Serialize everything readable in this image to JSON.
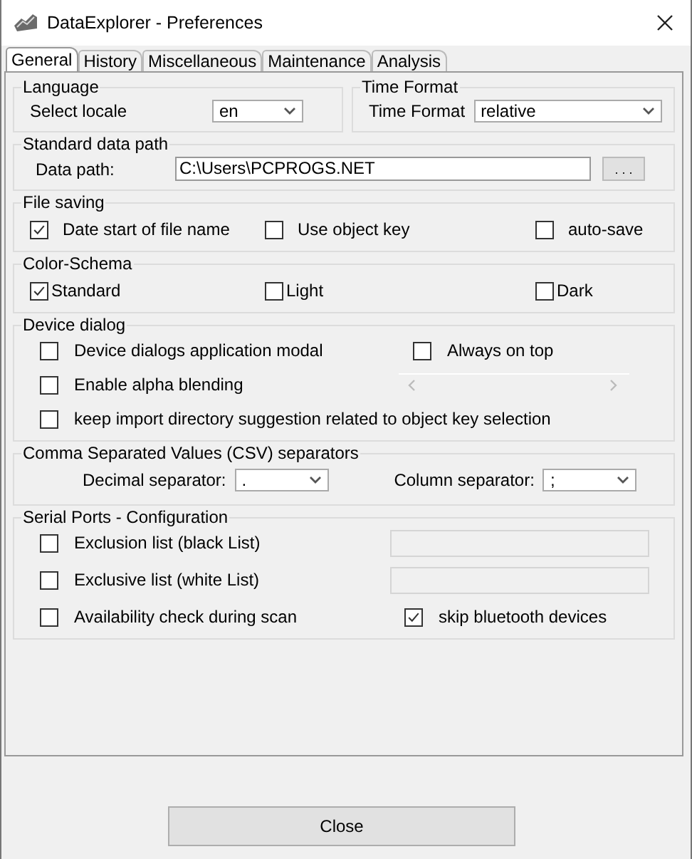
{
  "window": {
    "title": "DataExplorer - Preferences"
  },
  "tabs": [
    {
      "label": "General",
      "selected": true
    },
    {
      "label": "History",
      "selected": false
    },
    {
      "label": "Miscellaneous",
      "selected": false
    },
    {
      "label": "Maintenance",
      "selected": false
    },
    {
      "label": "Analysis",
      "selected": false
    }
  ],
  "language": {
    "title": "Language",
    "label": "Select locale",
    "value": "en"
  },
  "time_format": {
    "title": "Time Format",
    "label": "Time Format",
    "value": "relative"
  },
  "data_path": {
    "title": "Standard data path",
    "label": "Data path:",
    "value": "C:\\Users\\PCPROGS.NET",
    "browse": ". . ."
  },
  "file_saving": {
    "title": "File saving",
    "options": [
      {
        "label": "Date start of file name",
        "checked": true
      },
      {
        "label": "Use object key",
        "checked": false
      },
      {
        "label": "auto-save",
        "checked": false
      }
    ]
  },
  "color_schema": {
    "title": "Color-Schema",
    "options": [
      {
        "label": "Standard",
        "checked": true
      },
      {
        "label": "Light",
        "checked": false
      },
      {
        "label": "Dark",
        "checked": false
      }
    ]
  },
  "device_dialog": {
    "title": "Device dialog",
    "rows": [
      [
        {
          "kind": "checkbox",
          "label": "Device dialogs application modal",
          "checked": false
        },
        {
          "kind": "checkbox",
          "label": "Always on top",
          "checked": false
        }
      ],
      [
        {
          "kind": "checkbox",
          "label": "Enable alpha blending",
          "checked": false
        },
        {
          "kind": "scrollbar"
        }
      ],
      [
        {
          "kind": "checkbox",
          "label": "keep import directory suggestion related to object key selection",
          "checked": false
        }
      ]
    ]
  },
  "csv": {
    "title": "Comma Separated Values (CSV) separators",
    "decimal": {
      "label": "Decimal separator:",
      "value": "."
    },
    "column": {
      "label": "Column separator:",
      "value": ";"
    }
  },
  "serial": {
    "title": "Serial Ports - Configuration",
    "rows": [
      [
        {
          "kind": "checkbox",
          "label": "Exclusion list (black List)",
          "checked": false
        },
        {
          "kind": "field"
        }
      ],
      [
        {
          "kind": "checkbox",
          "label": "Exclusive list (white List)",
          "checked": false
        },
        {
          "kind": "field"
        }
      ],
      [
        {
          "kind": "checkbox",
          "label": "Availability check during scan",
          "checked": false
        },
        {
          "kind": "checkbox",
          "label": "skip bluetooth devices",
          "checked": true
        }
      ]
    ]
  },
  "buttons": [
    {
      "label": "Close"
    }
  ]
}
